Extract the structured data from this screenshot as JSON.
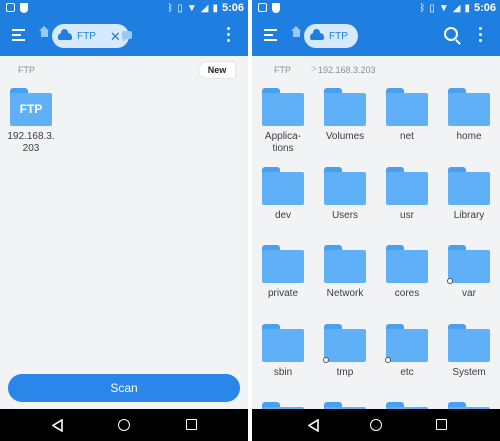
{
  "status_bar": {
    "time": "5:06"
  },
  "left_screen": {
    "tab": {
      "label": "FTP",
      "close": "✕"
    },
    "breadcrumb": {
      "root": "FTP"
    },
    "new_button": "New",
    "server": {
      "folder_label": "FTP",
      "name_line1": "192.168.3.",
      "name_line2": "203"
    },
    "scan_button": "Scan"
  },
  "right_screen": {
    "tab": {
      "label": "FTP"
    },
    "breadcrumb": {
      "root": "FTP",
      "separator": ">",
      "current": "192.168.3.203"
    },
    "folders": [
      {
        "name": "Applications",
        "line1": "Applica-",
        "line2": "tions",
        "link": false
      },
      {
        "name": "Volumes",
        "line1": "Volumes",
        "line2": "",
        "link": false
      },
      {
        "name": "net",
        "line1": "net",
        "line2": "",
        "link": false
      },
      {
        "name": "home",
        "line1": "home",
        "line2": "",
        "link": false
      },
      {
        "name": "dev",
        "line1": "dev",
        "line2": "",
        "link": false
      },
      {
        "name": "Users",
        "line1": "Users",
        "line2": "",
        "link": false
      },
      {
        "name": "usr",
        "line1": "usr",
        "line2": "",
        "link": false
      },
      {
        "name": "Library",
        "line1": "Library",
        "line2": "",
        "link": false
      },
      {
        "name": "private",
        "line1": "private",
        "line2": "",
        "link": false
      },
      {
        "name": "Network",
        "line1": "Network",
        "line2": "",
        "link": false
      },
      {
        "name": "cores",
        "line1": "cores",
        "line2": "",
        "link": false
      },
      {
        "name": "var",
        "line1": "var",
        "line2": "",
        "link": true
      },
      {
        "name": "sbin",
        "line1": "sbin",
        "line2": "",
        "link": false
      },
      {
        "name": "tmp",
        "line1": "tmp",
        "line2": "",
        "link": true
      },
      {
        "name": "etc",
        "line1": "etc",
        "line2": "",
        "link": true
      },
      {
        "name": "System",
        "line1": "System",
        "line2": "",
        "link": false
      },
      {
        "name": "",
        "line1": "",
        "line2": "",
        "link": false
      },
      {
        "name": "",
        "line1": "",
        "line2": "",
        "link": false
      },
      {
        "name": "",
        "line1": "",
        "line2": "",
        "link": false
      },
      {
        "name": "",
        "line1": "",
        "line2": "",
        "link": false
      }
    ]
  },
  "icons": {
    "status_left": [
      "app-square-icon",
      "shield-icon"
    ],
    "status_right": [
      "bluetooth-icon",
      "vibrate-icon",
      "wifi-icon",
      "signal-icon",
      "battery-icon"
    ],
    "appbar": [
      "menu-icon",
      "home-icon",
      "cloud-icon",
      "chat-icon",
      "search-icon",
      "overflow-menu-icon"
    ],
    "navbar": [
      "back-icon",
      "home-circle-icon",
      "recents-icon"
    ]
  },
  "colors": {
    "accent": "#1e7fe0",
    "folder": "#5fb0f6",
    "background": "#f2f3f5",
    "navbar": "#000000"
  }
}
